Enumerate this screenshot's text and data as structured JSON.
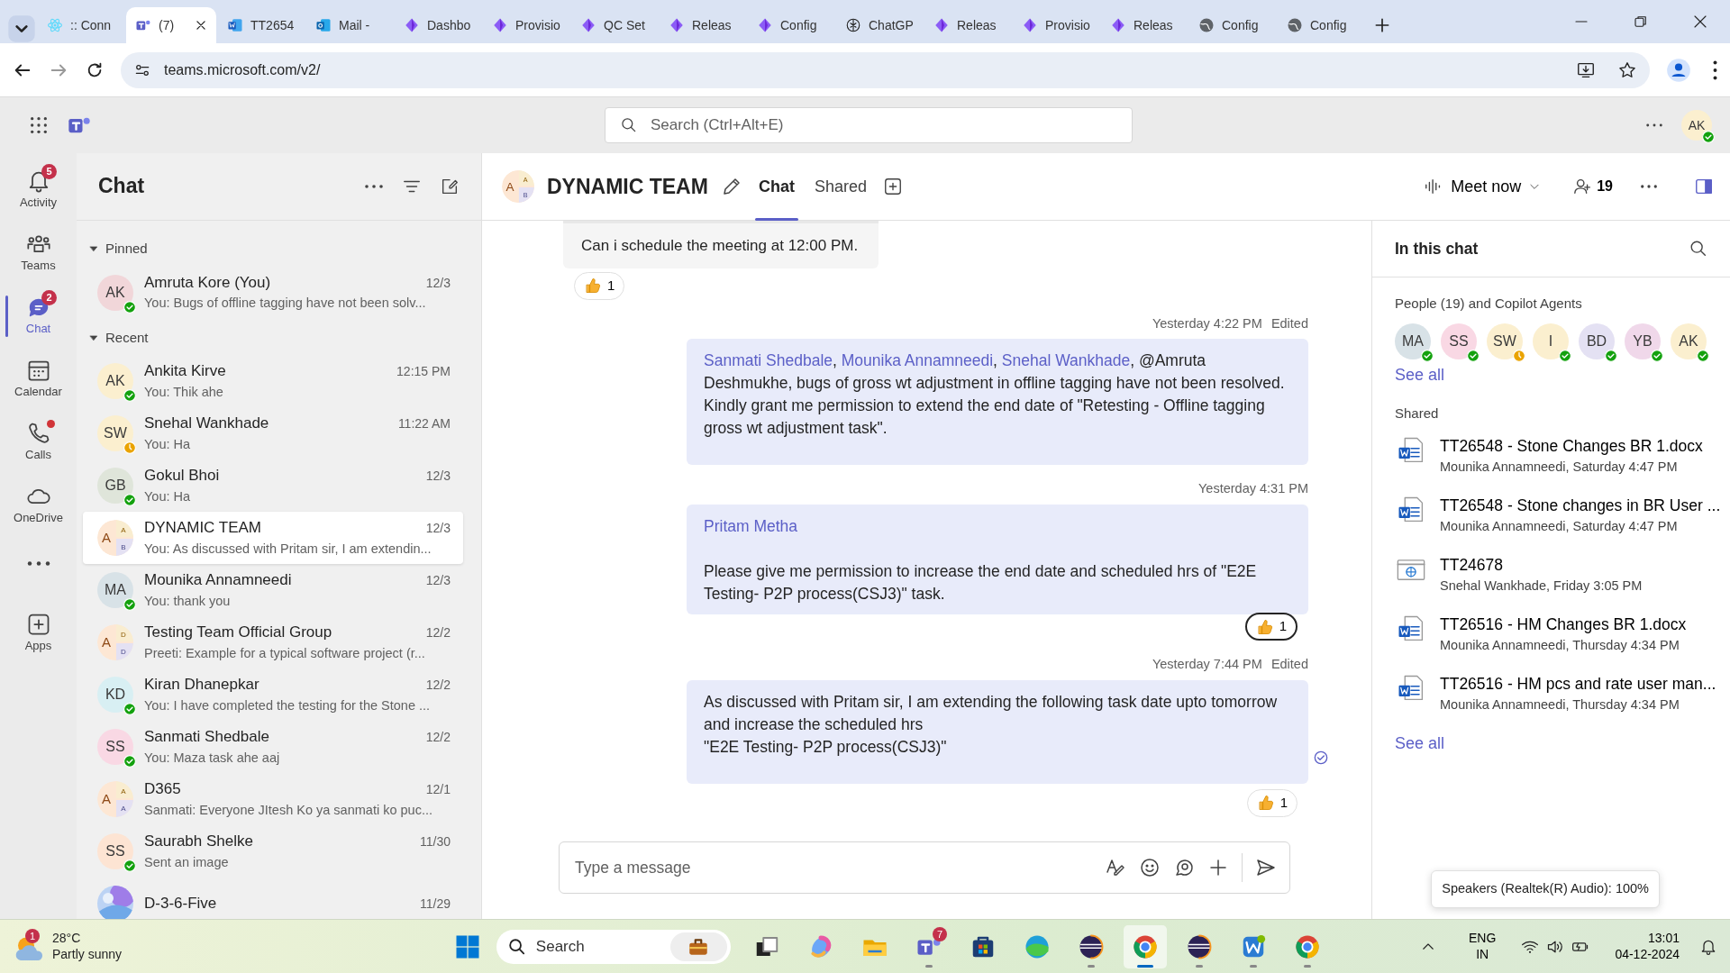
{
  "browser": {
    "tabs": [
      {
        "title": ":: Conn",
        "kind": "atom",
        "selected": false
      },
      {
        "title": "(7)",
        "kind": "teams",
        "selected": true
      },
      {
        "title": "TT2654",
        "kind": "word",
        "selected": false
      },
      {
        "title": "Mail -",
        "kind": "mail",
        "selected": false
      },
      {
        "title": "Dashbo",
        "kind": "diamond",
        "selected": false
      },
      {
        "title": "Provisio",
        "kind": "diamond",
        "selected": false
      },
      {
        "title": "QC Set",
        "kind": "diamond",
        "selected": false
      },
      {
        "title": "Releas",
        "kind": "diamond",
        "selected": false
      },
      {
        "title": "Config",
        "kind": "diamond",
        "selected": false
      },
      {
        "title": "ChatGP",
        "kind": "knot",
        "selected": false
      },
      {
        "title": "Releas",
        "kind": "diamond",
        "selected": false
      },
      {
        "title": "Provisio",
        "kind": "diamond",
        "selected": false
      },
      {
        "title": "Releas",
        "kind": "diamond",
        "selected": false
      },
      {
        "title": "Config",
        "kind": "globe",
        "selected": false
      },
      {
        "title": "Config",
        "kind": "globe",
        "selected": false
      }
    ],
    "url": "teams.microsoft.com/v2/"
  },
  "header": {
    "search_placeholder": "Search (Ctrl+Alt+E)",
    "user_initials": "AK"
  },
  "rail": [
    {
      "label": "Activity",
      "kind": "bell",
      "badge": "5",
      "dot": false,
      "selected": false
    },
    {
      "label": "Teams",
      "kind": "people",
      "dot": false,
      "selected": false
    },
    {
      "label": "Chat",
      "kind": "chat",
      "badge": "2",
      "dot": false,
      "selected": true
    },
    {
      "label": "Calendar",
      "kind": "calendar",
      "dot": false,
      "selected": false
    },
    {
      "label": "Calls",
      "kind": "phone",
      "dot": true,
      "selected": false
    },
    {
      "label": "OneDrive",
      "kind": "cloud",
      "dot": false,
      "selected": false
    },
    {
      "kind": "more",
      "dot": false,
      "selected": false
    },
    {
      "label": "Apps",
      "kind": "apps",
      "dot": false,
      "selected": false
    }
  ],
  "chat_list": {
    "title": "Chat",
    "sections": [
      {
        "label": "Pinned",
        "expanded": true,
        "items": [
          {
            "kind": "person",
            "initials": "AK",
            "color": "#f1d6d9",
            "name": "Amruta Kore (You)",
            "time": "12/3",
            "preview": "You: Bugs of offline tagging have not been solv...",
            "away": false,
            "selected": false
          }
        ]
      },
      {
        "label": "Recent",
        "expanded": true,
        "items": [
          {
            "kind": "person",
            "initials": "AK",
            "color": "#fbefcf",
            "name": "Ankita Kirve",
            "time": "12:15 PM",
            "preview": "You: Thik ahe",
            "away": false,
            "selected": false
          },
          {
            "kind": "person",
            "initials": "SW",
            "color": "#fbefcf",
            "name": "Snehal Wankhade",
            "time": "11:22 AM",
            "preview": "You: Ha",
            "away": true,
            "selected": false
          },
          {
            "kind": "person",
            "initials": "GB",
            "color": "#dfe5da",
            "name": "Gokul Bhoi",
            "time": "12/3",
            "preview": "You: Ha",
            "away": false,
            "selected": false
          },
          {
            "kind": "group",
            "letters": [
              "A",
              "A",
              "B"
            ],
            "name": "DYNAMIC TEAM",
            "time": "12/3",
            "preview": "You: As discussed with Pritam sir, I am extendin...",
            "selected": true
          },
          {
            "kind": "person",
            "initials": "MA",
            "color": "#d8e2e7",
            "name": "Mounika Annamneedi",
            "time": "12/3",
            "preview": "You: thank you",
            "away": false,
            "selected": false
          },
          {
            "kind": "group",
            "letters": [
              "A",
              "D",
              "D"
            ],
            "name": "Testing Team Official Group",
            "time": "12/2",
            "preview": "Preeti: Example for a typical software project (r...",
            "selected": false
          },
          {
            "kind": "person",
            "initials": "KD",
            "color": "#d8eff3",
            "name": "Kiran Dhanepkar",
            "time": "12/2",
            "preview": "You: I have completed the testing for the Stone ...",
            "away": false,
            "selected": false
          },
          {
            "kind": "person",
            "initials": "SS",
            "color": "#f9d8e4",
            "name": "Sanmati Shedbale",
            "time": "12/2",
            "preview": "You: Maza task ahe aaj",
            "away": false,
            "selected": false
          },
          {
            "kind": "group",
            "letters": [
              "A",
              "A",
              "A"
            ],
            "name": "D365",
            "time": "12/1",
            "preview": "Sanmati: Everyone JItesh Ko ya sanmati ko puc...",
            "selected": false
          },
          {
            "kind": "person",
            "initials": "SS",
            "color": "#fde4d3",
            "name": "Saurabh Shelke",
            "time": "11/30",
            "preview": "Sent an image",
            "away": false,
            "selected": false
          },
          {
            "kind": "picture",
            "name": "D-3-6-Five",
            "time": "11/29",
            "selected": false
          }
        ]
      }
    ]
  },
  "conversation": {
    "title": "DYNAMIC TEAM",
    "group_letters": [
      "A",
      "A",
      "B"
    ],
    "tabs": [
      {
        "label": "Chat",
        "selected": true
      },
      {
        "label": "Shared",
        "selected": false
      }
    ],
    "meet_now": "Meet now",
    "participants": "19",
    "messages": [
      {
        "kind": "received",
        "paragraphs": [
          [
            {
              "text": "Can i schedule the meeting at 12:00 PM.",
              "mention": false
            }
          ]
        ],
        "reaction": {
          "count": "1",
          "mine": false
        }
      },
      {
        "kind": "sent",
        "meta": "Yesterday 4:22 PM",
        "edited": "Edited",
        "paragraphs": [
          [
            {
              "text": "Sanmati Shedbale",
              "mention": true
            },
            {
              "text": ", ",
              "mention": false
            },
            {
              "text": "Mounika Annamneedi",
              "mention": true
            },
            {
              "text": ", ",
              "mention": false
            },
            {
              "text": "Snehal Wankhade",
              "mention": true
            },
            {
              "text": ", @Amruta Deshmukhe, bugs of gross wt adjustment in offline tagging have not been resolved. Kindly grant me permission to extend the end date of \"Retesting  - Offline tagging gross wt adjustment task\".",
              "mention": false
            }
          ]
        ],
        "read": false
      },
      {
        "kind": "sent",
        "meta": "Yesterday 4:31 PM",
        "paragraphs": [
          [
            {
              "text": "Pritam Metha",
              "mention": true
            }
          ],
          [
            {
              "text": "Please give me permission to increase the end date and scheduled hrs of \"E2E Testing- P2P process(CSJ3)\" task.",
              "mention": false
            }
          ]
        ],
        "reaction": {
          "count": "1",
          "mine": true
        },
        "read": false
      },
      {
        "kind": "sent",
        "meta": "Yesterday 7:44 PM",
        "edited": "Edited",
        "paragraphs": [
          [
            {
              "text": "As discussed with Pritam sir, I am extending the following task date upto tomorrow and increase the scheduled hrs",
              "mention": false
            }
          ],
          [
            {
              "text": "\"E2E Testing- P2P process(CSJ3)\"",
              "mention": false
            }
          ]
        ],
        "reaction": {
          "count": "1",
          "mine": false
        },
        "read": true
      }
    ],
    "composer_placeholder": "Type a message"
  },
  "side_panel": {
    "title": "In this chat",
    "people_label": "People (19) and Copilot Agents",
    "people": [
      {
        "initials": "MA",
        "color": "#d8e2e7",
        "away": false
      },
      {
        "initials": "SS",
        "color": "#f9d8e4",
        "away": false
      },
      {
        "initials": "SW",
        "color": "#fbefcf",
        "away": true
      },
      {
        "initials": "I",
        "color": "#fbefcf",
        "away": false
      },
      {
        "initials": "BD",
        "color": "#e4e1f3",
        "away": false
      },
      {
        "initials": "YB",
        "color": "#f0d8ea",
        "away": false
      },
      {
        "initials": "AK",
        "color": "#fbefcf",
        "away": false
      }
    ],
    "people_see_all": "See all",
    "shared_label": "Shared",
    "files": [
      {
        "kind": "word",
        "name": "TT26548 - Stone Changes BR 1.docx",
        "meta": "Mounika Annamneedi, Saturday 4:47 PM"
      },
      {
        "kind": "word",
        "name": "TT26548 - Stone changes in BR User ...",
        "meta": "Mounika Annamneedi, Saturday 4:47 PM"
      },
      {
        "kind": "web",
        "name": "TT24678",
        "meta": "Snehal Wankhade, Friday 3:05 PM"
      },
      {
        "kind": "word",
        "name": "TT26516 - HM Changes BR 1.docx",
        "meta": "Mounika Annamneedi, Thursday 4:34 PM"
      },
      {
        "kind": "word",
        "name": "TT26516 - HM pcs and rate user man...",
        "meta": "Mounika Annamneedi, Thursday 4:34 PM"
      }
    ],
    "files_see_all": "See all"
  },
  "toast": "Speakers (Realtek(R) Audio): 100%",
  "taskbar": {
    "weather_badge": "1",
    "temperature": "28°C",
    "condition": "Partly sunny",
    "search_placeholder": "Search",
    "apps": [
      {
        "kind": "taskview",
        "open": false,
        "selected": false
      },
      {
        "kind": "blob",
        "open": false,
        "selected": false
      },
      {
        "kind": "folder",
        "open": false,
        "selected": false
      },
      {
        "kind": "teams",
        "badge": "7",
        "open": true,
        "selected": false
      },
      {
        "kind": "store",
        "open": false,
        "selected": false
      },
      {
        "kind": "wave",
        "open": false,
        "selected": false
      },
      {
        "kind": "eclipse",
        "open": true,
        "selected": false
      },
      {
        "kind": "chrome",
        "open": true,
        "selected": true
      },
      {
        "kind": "eclipse",
        "open": true,
        "selected": false
      },
      {
        "kind": "wdoc",
        "open": true,
        "selected": false
      },
      {
        "kind": "chrome",
        "open": true,
        "selected": false
      }
    ],
    "language": "ENG",
    "region": "IN",
    "time": "13:01",
    "date": "04-12-2024"
  }
}
